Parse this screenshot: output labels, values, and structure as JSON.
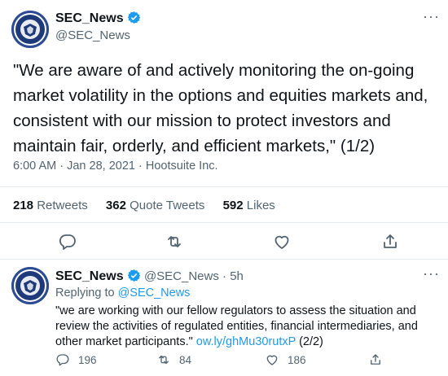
{
  "tweet": {
    "display_name": "SEC_News",
    "handle": "@SEC_News",
    "text": "\"We are aware of and actively monitoring the on-going market volatility in the options and equities markets and, consistent with our mission to protect investors and maintain fair, orderly, and efficient markets,\" (1/2)",
    "time": "6:00 AM",
    "separator": "·",
    "date": "Jan 28, 2021",
    "source": "Hootsuite Inc.",
    "stats": [
      {
        "count": "218",
        "label": "Retweets"
      },
      {
        "count": "362",
        "label": "Quote Tweets"
      },
      {
        "count": "592",
        "label": "Likes"
      }
    ],
    "actions": [
      "reply-icon",
      "retweet-icon",
      "like-icon",
      "share-icon"
    ]
  },
  "reply": {
    "display_name": "SEC_News",
    "handle": "@SEC_News",
    "separator": "·",
    "age": "5h",
    "replying_prefix": "Replying to",
    "replying_to": "@SEC_News",
    "text": "\"we are working with our fellow regulators to assess the situation and review the activities of regulated entities, financial intermediaries, and other market participants.\"",
    "link": "ow.ly/ghMu30rutxP",
    "suffix": "(2/2)",
    "counts": {
      "replies": "196",
      "retweets": "84",
      "likes": "186"
    }
  },
  "colors": {
    "accent": "#1d9bf0",
    "text": "#0f1419",
    "muted": "#536471",
    "seal": "#1e3a7a"
  }
}
